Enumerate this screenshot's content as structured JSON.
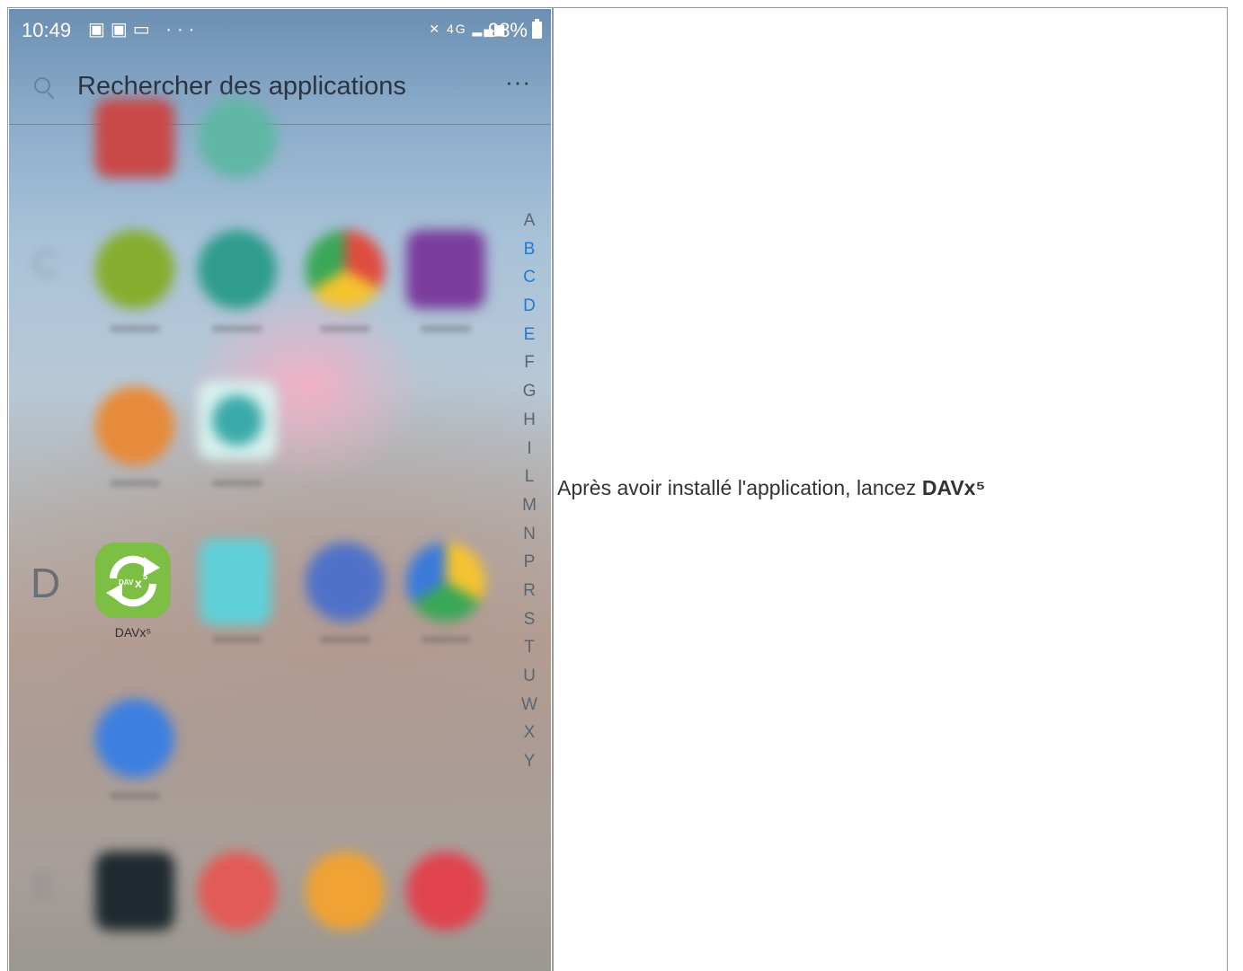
{
  "phone": {
    "status_bar": {
      "time": "10:49",
      "left_icons": [
        "image-icon",
        "gallery-icon",
        "message-icon"
      ],
      "left_more": "···",
      "network": "4G",
      "battery": "98%"
    },
    "search": {
      "placeholder": "Rechercher des applications",
      "more": "⋮"
    },
    "section_letter": "D",
    "featured_app": {
      "label": "DAVx⁵",
      "icon_text": "DAV x5"
    },
    "alphabet_index": [
      "A",
      "B",
      "C",
      "D",
      "E",
      "F",
      "G",
      "H",
      "I",
      "L",
      "M",
      "N",
      "P",
      "R",
      "S",
      "T",
      "U",
      "W",
      "X",
      "Y"
    ],
    "alphabet_highlighted": [
      "B",
      "C",
      "D",
      "E"
    ],
    "accent_color": "#1f7cd6"
  },
  "caption": {
    "text": "Après avoir installé l'application, lancez ",
    "bold": "DAVx⁵"
  }
}
